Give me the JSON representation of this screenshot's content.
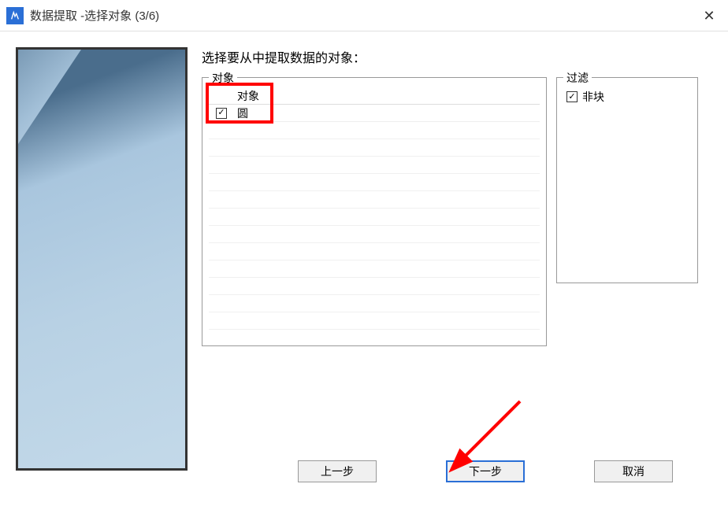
{
  "window": {
    "title": "数据提取 -选择对象 (3/6)"
  },
  "instruction": "选择要从中提取数据的对象：",
  "object_group": {
    "label": "对象",
    "header_col_object": "对象",
    "rows": [
      {
        "checked": true,
        "name": "圆"
      }
    ]
  },
  "filter_group": {
    "label": "过滤",
    "items": [
      {
        "checked": true,
        "label": "非块"
      }
    ]
  },
  "buttons": {
    "back": "上一步",
    "next": "下一步",
    "cancel": "取消"
  },
  "annotations": {
    "highlight_object_list_header": true,
    "arrow_to_next_button": true
  }
}
